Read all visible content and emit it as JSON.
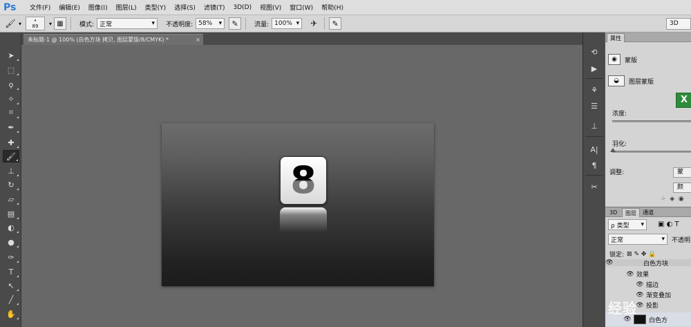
{
  "app": {
    "logo": "Ps"
  },
  "menubar": {
    "items": [
      "文件(F)",
      "编辑(E)",
      "图像(I)",
      "图层(L)",
      "类型(Y)",
      "选择(S)",
      "滤镜(T)",
      "3D(D)",
      "视图(V)",
      "窗口(W)",
      "帮助(H)"
    ]
  },
  "options_bar": {
    "brush_size": "89",
    "mode_label": "模式:",
    "mode_value": "正常",
    "opacity_label": "不透明度:",
    "opacity_value": "58%",
    "flow_label": "流量:",
    "flow_value": "100%",
    "right_box": "3D"
  },
  "document": {
    "tab_title": "未标题-1 @ 100% (白色方块 拷贝, 图层蒙版/8/CMYK) *",
    "close": "×",
    "tile_digit": "8"
  },
  "properties_panel": {
    "tab": "属性",
    "header": "蒙版",
    "mask_label": "图层蒙版",
    "density_label": "浓度:",
    "feather_label": "羽化:",
    "adjust_label": "调整:",
    "btn1": "蒙",
    "btn2": "颜",
    "excel_letter": "X"
  },
  "layers_panel": {
    "tabs": [
      "3D",
      "图层",
      "通道"
    ],
    "filter_value": "ρ 类型",
    "blend_value": "正常",
    "opacity_label": "不透明",
    "lock_label": "锁定:",
    "rows": [
      {
        "name": "白色方块",
        "indent": 2
      },
      {
        "name": "效果",
        "indent": 1
      },
      {
        "name": "描边",
        "indent": 2
      },
      {
        "name": "渐变叠加",
        "indent": 2
      },
      {
        "name": "投影",
        "indent": 2
      },
      {
        "name": "白色方",
        "indent": 1
      }
    ]
  },
  "watermark": "经验"
}
